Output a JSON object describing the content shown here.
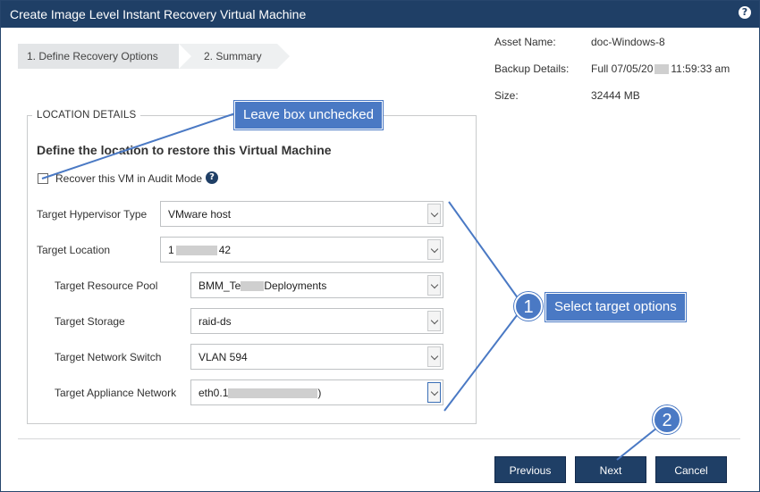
{
  "window": {
    "title": "Create Image Level Instant Recovery Virtual Machine",
    "help_glyph": "?"
  },
  "wizard": {
    "steps": [
      {
        "label": "1. Define Recovery Options",
        "active": true
      },
      {
        "label": "2. Summary",
        "active": false
      }
    ]
  },
  "asset_info": {
    "asset_name_label": "Asset Name:",
    "asset_name_value": "doc-Windows-8",
    "backup_details_label": "Backup Details:",
    "backup_details_prefix": "Full 07/05/20",
    "backup_details_suffix": "11:59:33 am",
    "size_label": "Size:",
    "size_value": "32444 MB"
  },
  "location": {
    "legend": "LOCATION DETAILS",
    "heading": "Define the location to restore this Virtual Machine",
    "audit_checkbox_label": "Recover this VM in Audit Mode",
    "audit_checked": false,
    "fields": {
      "hypervisor": {
        "label": "Target Hypervisor Type",
        "value": "VMware host"
      },
      "location": {
        "label": "Target Location",
        "value_prefix": "1",
        "value_suffix": "42"
      },
      "resource_pool": {
        "label": "Target Resource Pool",
        "value_prefix": "BMM_Te",
        "value_suffix": "Deployments"
      },
      "storage": {
        "label": "Target Storage",
        "value": "raid-ds"
      },
      "network_switch": {
        "label": "Target Network Switch",
        "value": "VLAN 594"
      },
      "appliance_network": {
        "label": "Target Appliance Network",
        "value_prefix": "eth0.1",
        "value_suffix": ")"
      }
    }
  },
  "annotations": {
    "callout_checkbox": "Leave box unchecked",
    "callout_options": "Select target options",
    "badge_1": "1",
    "badge_2": "2",
    "accent_color": "#4a79c4"
  },
  "buttons": {
    "previous": "Previous",
    "next": "Next",
    "cancel": "Cancel"
  },
  "colors": {
    "titlebar": "#1f3f66",
    "button": "#1f3f66"
  }
}
